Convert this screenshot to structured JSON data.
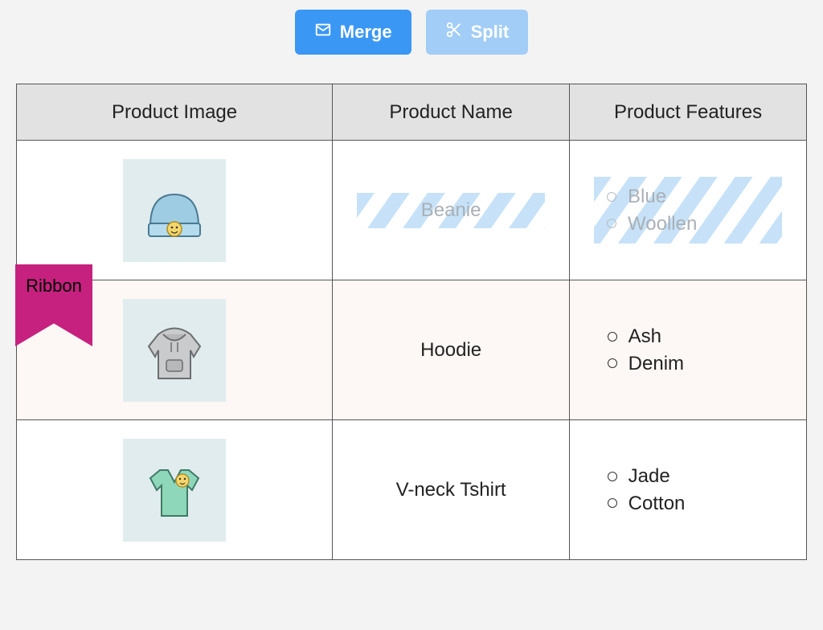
{
  "toolbar": {
    "merge_label": "Merge",
    "split_label": "Split"
  },
  "table": {
    "headers": {
      "image": "Product Image",
      "name": "Product Name",
      "features": "Product Features"
    },
    "rows": [
      {
        "name": "Beanie",
        "features": [
          "Blue",
          "Woollen"
        ],
        "selected": true,
        "ribbon": null
      },
      {
        "name": "Hoodie",
        "features": [
          "Ash",
          "Denim"
        ],
        "selected": false,
        "ribbon": "Ribbon"
      },
      {
        "name": "V-neck Tshirt",
        "features": [
          "Jade",
          "Cotton"
        ],
        "selected": false,
        "ribbon": null
      }
    ]
  },
  "colors": {
    "primary": "#3a97f4",
    "disabled": "#a2cdf7",
    "ribbon": "#c6217f"
  }
}
